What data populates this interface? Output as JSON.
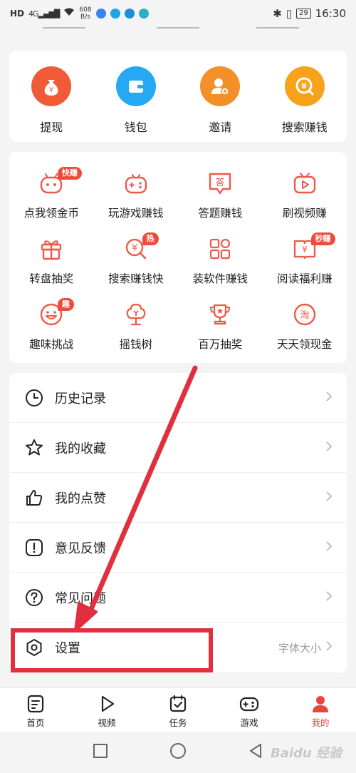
{
  "status_bar": {
    "network": "HD",
    "signal": "4G",
    "speed": "608",
    "speed_unit": "B/s",
    "battery": "29",
    "time": "16:30"
  },
  "top_actions": [
    {
      "label": "提现",
      "icon": "money-bag-icon",
      "color": "#f05a36"
    },
    {
      "label": "钱包",
      "icon": "wallet-icon",
      "color": "#27a8f2"
    },
    {
      "label": "邀请",
      "icon": "invite-user-icon",
      "color": "#f4902a"
    },
    {
      "label": "搜索赚钱",
      "icon": "search-coin-icon",
      "color": "#f7a21b"
    }
  ],
  "tasks": [
    {
      "label": "点我领金币",
      "icon": "robot-coin-icon",
      "badge": "快赚"
    },
    {
      "label": "玩游戏赚钱",
      "icon": "gamepad-icon",
      "badge": ""
    },
    {
      "label": "答题赚钱",
      "icon": "answer-bubble-icon",
      "badge": ""
    },
    {
      "label": "刷视频赚",
      "icon": "tv-play-icon",
      "badge": ""
    },
    {
      "label": "转盘抽奖",
      "icon": "gift-box-icon",
      "badge": ""
    },
    {
      "label": "搜索赚钱快",
      "icon": "search-yen-icon",
      "badge": "热"
    },
    {
      "label": "装软件赚钱",
      "icon": "apps-grid-icon",
      "badge": ""
    },
    {
      "label": "阅读福利赚",
      "icon": "book-yen-icon",
      "badge": "秒赚"
    },
    {
      "label": "趣味挑战",
      "icon": "smiley-icon",
      "badge": "趣"
    },
    {
      "label": "摇钱树",
      "icon": "money-tree-icon",
      "badge": ""
    },
    {
      "label": "百万抽奖",
      "icon": "trophy-icon",
      "badge": ""
    },
    {
      "label": "天天领现金",
      "icon": "taobao-coin-icon",
      "badge": ""
    }
  ],
  "menu": [
    {
      "label": "历史记录",
      "icon": "clock-icon",
      "right": ""
    },
    {
      "label": "我的收藏",
      "icon": "star-icon",
      "right": ""
    },
    {
      "label": "我的点赞",
      "icon": "thumbs-up-icon",
      "right": ""
    },
    {
      "label": "意见反馈",
      "icon": "feedback-icon",
      "right": ""
    },
    {
      "label": "常见问题",
      "icon": "question-icon",
      "right": ""
    },
    {
      "label": "设置",
      "icon": "settings-icon",
      "right": "字体大小"
    }
  ],
  "bottom_nav": [
    {
      "label": "首页",
      "icon": "home-doc-icon",
      "active": false
    },
    {
      "label": "视频",
      "icon": "play-icon",
      "active": false
    },
    {
      "label": "任务",
      "icon": "calendar-check-icon",
      "active": false
    },
    {
      "label": "游戏",
      "icon": "gamepad-icon",
      "active": false
    },
    {
      "label": "我的",
      "icon": "user-icon",
      "active": true
    }
  ],
  "watermark": "Baidu 经验",
  "colors": {
    "accent": "#e8453c",
    "annotation": "#e0303f"
  }
}
